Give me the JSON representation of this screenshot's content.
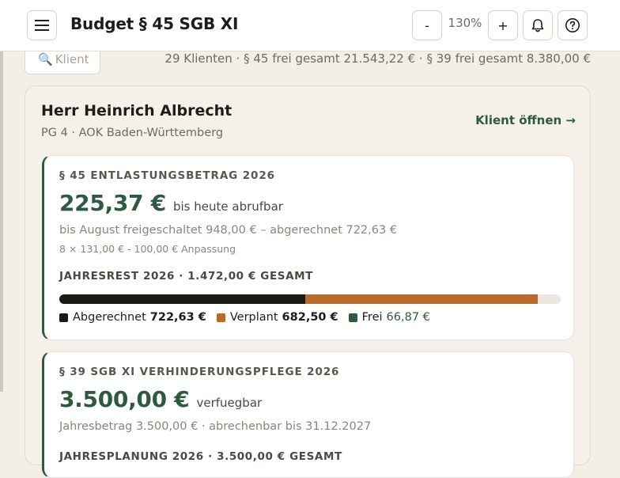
{
  "header": {
    "title": "Budget § 45 SGB XI",
    "zoom_minus": "-",
    "zoom_level": "130%",
    "zoom_plus": "+"
  },
  "search": {
    "placeholder": "Klient"
  },
  "summary": "29 Klienten · § 45 frei gesamt 21.543,22 € · § 39 frei gesamt 8.380,00 €",
  "client": {
    "name": "Herr Heinrich Albrecht",
    "meta": "PG 4 · AOK Baden-Württemberg",
    "open_label": "Klient öffnen →"
  },
  "budget45": {
    "heading": "§ 45 ENTLASTUNGSBETRAG 2026",
    "amount": "225,37 €",
    "amount_note": "bis heute abrufbar",
    "sub": "bis August freigeschaltet 948,00 € – abgerechnet 722,63 €",
    "sub2": "8 × 131,00 € - 100,00 € Anpassung",
    "rest": "JAHRESREST 2026 · 1.472,00 € GESAMT",
    "bar": {
      "total": 1472.0,
      "segments": [
        {
          "name": "Abgerechnet",
          "value": 722.63,
          "color": "#1c1a17"
        },
        {
          "name": "Verplant",
          "value": 682.5,
          "color": "#b8692c"
        },
        {
          "name": "Frei",
          "value": 66.87,
          "color": "#ebe7df"
        }
      ]
    },
    "legend": [
      {
        "label": "Abgerechnet",
        "value": "722,63 €",
        "color": "#1c1a17"
      },
      {
        "label": "Verplant",
        "value": "682,50 €",
        "color": "#b8692c"
      },
      {
        "label": "Frei",
        "value": "66,87 €",
        "color": "#2e5a3f"
      }
    ]
  },
  "budget39": {
    "heading": "§ 39 SGB XI VERHINDERUNGSPFLEGE 2026",
    "amount": "3.500,00 €",
    "amount_note": "verfuegbar",
    "sub": "Jahresbetrag 3.500,00 € · abrechenbar bis 31.12.2027",
    "cut": "JAHRESPLANUNG 2026 · 3.500,00 € GESAMT"
  }
}
